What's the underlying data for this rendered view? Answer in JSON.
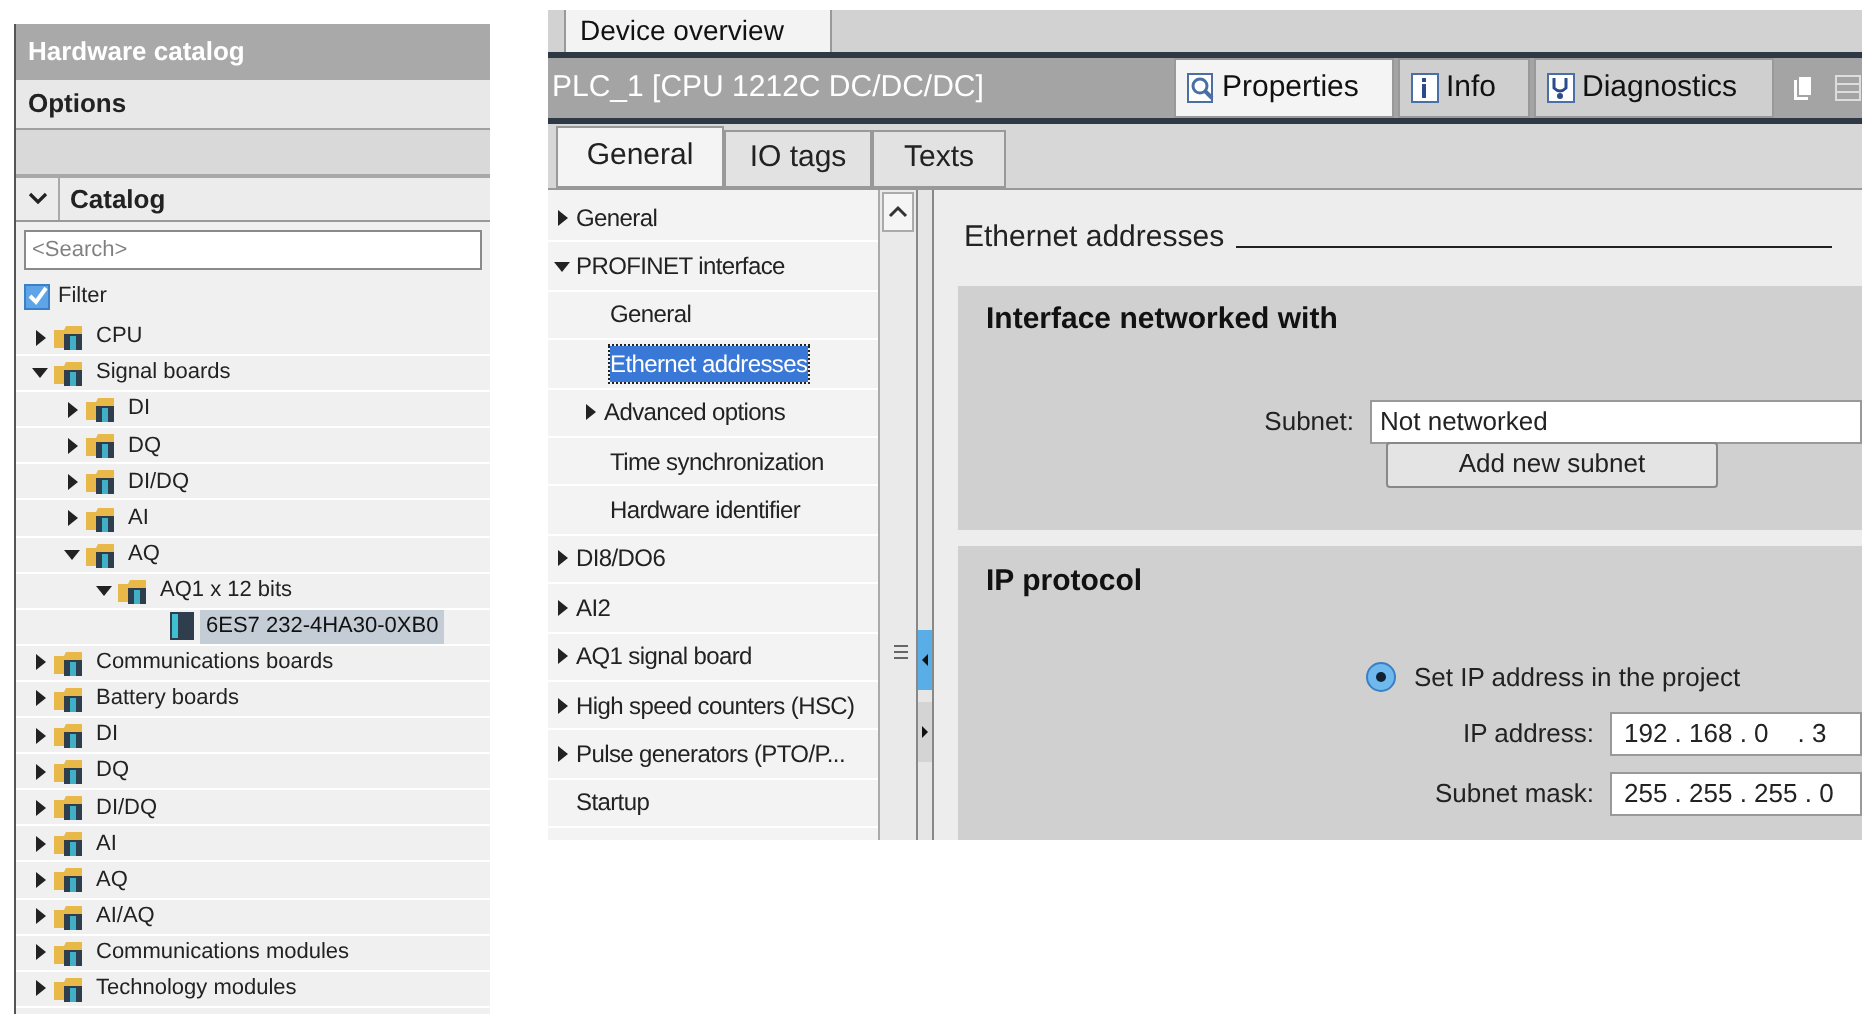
{
  "catalog": {
    "title": "Hardware catalog",
    "options_label": "Options",
    "section": {
      "label": "Catalog",
      "expanded": true
    },
    "search": {
      "placeholder": "<Search>"
    },
    "filter": {
      "label": "Filter",
      "checked": true
    },
    "tree": [
      {
        "kind": "folder",
        "label": "CPU",
        "expanded": false,
        "selected": false
      },
      {
        "kind": "folder",
        "label": "Signal boards",
        "expanded": true,
        "selected": false,
        "children": [
          {
            "kind": "folder",
            "label": "DI",
            "expanded": false,
            "selected": false
          },
          {
            "kind": "folder",
            "label": "DQ",
            "expanded": false,
            "selected": false
          },
          {
            "kind": "folder",
            "label": "DI/DQ",
            "expanded": false,
            "selected": false
          },
          {
            "kind": "folder",
            "label": "AI",
            "expanded": false,
            "selected": false
          },
          {
            "kind": "folder",
            "label": "AQ",
            "expanded": true,
            "selected": false,
            "children": [
              {
                "kind": "folder",
                "label": "AQ1 x 12 bits",
                "expanded": true,
                "selected": false,
                "children": [
                  {
                    "kind": "module",
                    "label": "6ES7 232-4HA30-0XB0",
                    "selected": true
                  }
                ]
              }
            ]
          }
        ]
      },
      {
        "kind": "folder",
        "label": "Communications boards",
        "expanded": false,
        "selected": false
      },
      {
        "kind": "folder",
        "label": "Battery boards",
        "expanded": false,
        "selected": false
      },
      {
        "kind": "folder",
        "label": "DI",
        "expanded": false,
        "selected": false
      },
      {
        "kind": "folder",
        "label": "DQ",
        "expanded": false,
        "selected": false
      },
      {
        "kind": "folder",
        "label": "DI/DQ",
        "expanded": false,
        "selected": false
      },
      {
        "kind": "folder",
        "label": "AI",
        "expanded": false,
        "selected": false
      },
      {
        "kind": "folder",
        "label": "AQ",
        "expanded": false,
        "selected": false
      },
      {
        "kind": "folder",
        "label": "AI/AQ",
        "expanded": false,
        "selected": false
      },
      {
        "kind": "folder",
        "label": "Communications modules",
        "expanded": false,
        "selected": false
      },
      {
        "kind": "folder",
        "label": "Technology modules",
        "expanded": false,
        "selected": false
      }
    ]
  },
  "inspector": {
    "view_tab": "Device overview",
    "title": "PLC_1 [CPU 1212C DC/DC/DC]",
    "tabs": [
      {
        "label": "Properties",
        "selected": true
      },
      {
        "label": "Info",
        "selected": false
      },
      {
        "label": "Diagnostics",
        "selected": false
      }
    ],
    "sub_tabs": [
      {
        "label": "General",
        "selected": true
      },
      {
        "label": "IO tags",
        "selected": false
      },
      {
        "label": "Texts",
        "selected": false
      }
    ],
    "nav": [
      {
        "label": "General",
        "expanded": false,
        "selected": false
      },
      {
        "label": "PROFINET interface",
        "expanded": true,
        "selected": false,
        "children": [
          {
            "label": "General",
            "selected": false
          },
          {
            "label": "Ethernet addresses",
            "selected": true
          },
          {
            "label": "Advanced options",
            "expanded": false,
            "selected": false
          },
          {
            "label": "Time synchronization",
            "selected": false
          },
          {
            "label": "Hardware identifier",
            "selected": false
          }
        ]
      },
      {
        "label": "DI8/DO6",
        "expanded": false,
        "selected": false
      },
      {
        "label": "AI2",
        "expanded": false,
        "selected": false
      },
      {
        "label": "AQ1 signal board",
        "expanded": false,
        "selected": false
      },
      {
        "label": "High speed counters (HSC)",
        "expanded": false,
        "selected": false
      },
      {
        "label": "Pulse generators (PTO/P...",
        "expanded": false,
        "selected": false
      },
      {
        "label": "Startup",
        "selected": false
      }
    ],
    "section_title": "Ethernet addresses",
    "network_group": {
      "title": "Interface networked with",
      "subnet_label": "Subnet:",
      "subnet_value": "Not networked",
      "button": "Add new subnet"
    },
    "ip_group": {
      "title": "IP protocol",
      "radio": {
        "label": "Set IP address in the project",
        "selected": true
      },
      "ip_label": "IP address:",
      "ip_value": "192 . 168 . 0    . 3",
      "mask_label": "Subnet mask:",
      "mask_value": "255 . 255 . 255 . 0"
    }
  }
}
